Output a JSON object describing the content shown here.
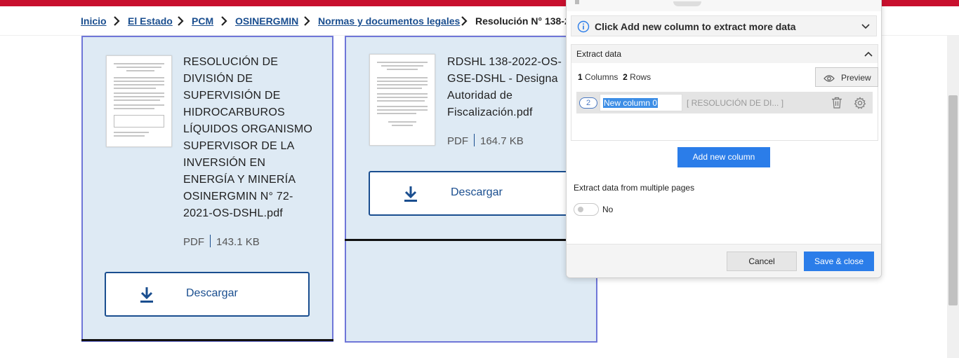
{
  "breadcrumb": {
    "items": [
      "Inicio",
      "El Estado",
      "PCM",
      "OSINERGMIN",
      "Normas y documentos legales"
    ],
    "current": "Resolución N° 138-2"
  },
  "documents": [
    {
      "title": "RESOLUCIÓN DE DIVISIÓN DE SUPERVISIÓN DE HIDROCARBUROS LÍQUIDOS ORGANISMO SUPERVISOR DE LA INVERSIÓN EN ENERGÍA Y MINERÍA OSINERGMIN N° 72-2021-OS-DSHL.pdf",
      "format": "PDF",
      "size": "143.1 KB",
      "button": "Descargar"
    },
    {
      "title": "RDSHL 138-2022-OS-GSE-DSHL - Designa Autoridad de Fiscalización.pdf",
      "format": "PDF",
      "size": "164.7 KB",
      "button": "Descargar"
    }
  ],
  "panel": {
    "info": "Click Add new column to extract more data",
    "extract_title": "Extract data",
    "columns_count": "1",
    "columns_label": "Columns",
    "rows_count": "2",
    "rows_label": "Rows",
    "preview": "Preview",
    "column": {
      "number": "2",
      "name": "New column 0",
      "sample": "[ RESOLUCIÓN DE DI... ]"
    },
    "add_column": "Add new column",
    "multi_pages_label": "Extract data from multiple pages",
    "multi_pages_value": "No",
    "cancel": "Cancel",
    "save": "Save & close"
  },
  "colors": {
    "brand_red": "#c8102e",
    "link_blue": "#1a4e8f",
    "card_bg": "#deeaf4",
    "card_border": "#6f76d8",
    "primary_button": "#2b7de9"
  }
}
